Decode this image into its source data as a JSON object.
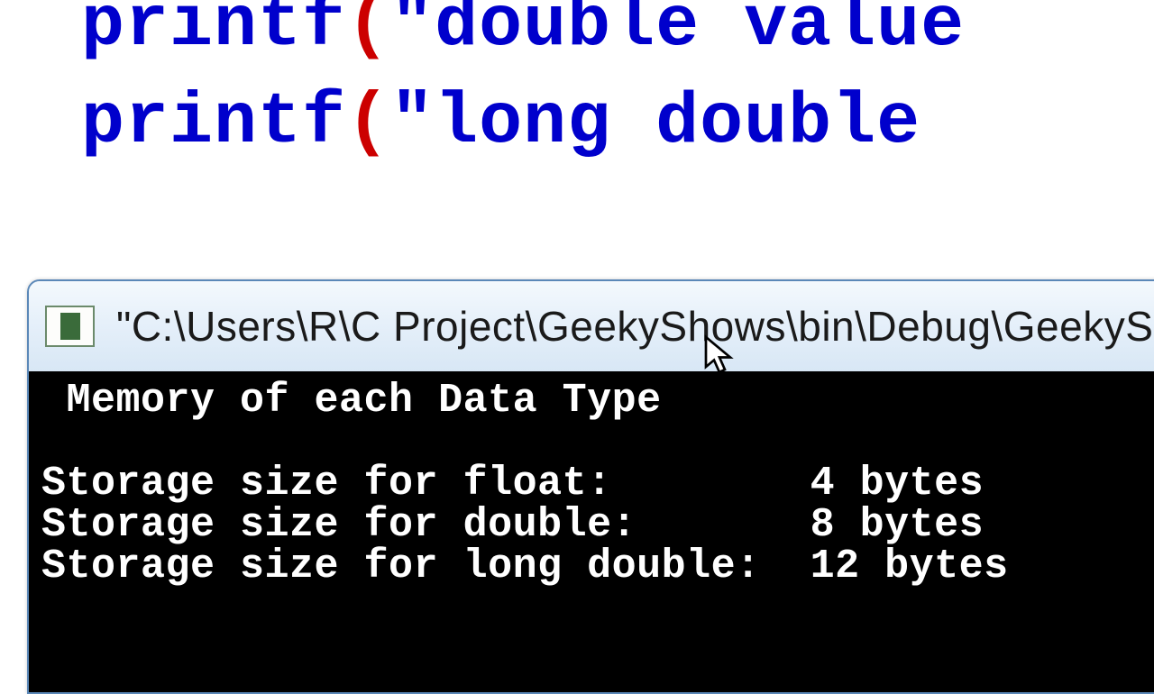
{
  "code": {
    "line1_printf": "printf",
    "line1_paren": "(",
    "line1_str": "\"double value",
    "line2_printf": "printf",
    "line2_paren": "(",
    "line2_str": "\"long double"
  },
  "window": {
    "title": "\"C:\\Users\\R\\C Project\\GeekyShows\\bin\\Debug\\GeekyShow"
  },
  "console": {
    "heading": " Memory of each Data Type",
    "blank": "",
    "line1": "Storage size for float:        4 bytes",
    "line2": "Storage size for double:       8 bytes",
    "line3": "Storage size for long double:  12 bytes"
  }
}
